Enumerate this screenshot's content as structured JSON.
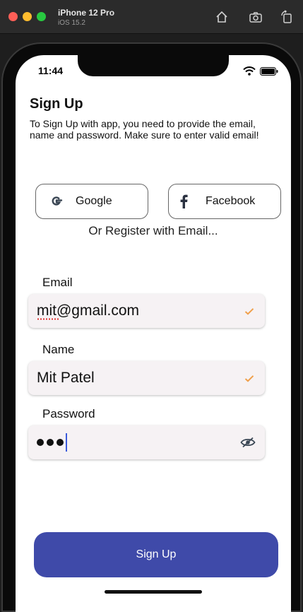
{
  "simulator": {
    "device_name": "iPhone 12 Pro",
    "os_version": "iOS 15.2"
  },
  "status_bar": {
    "time": "11:44"
  },
  "header": {
    "title": "Sign Up",
    "description": "To Sign Up with app, you need to provide the email, name  and password. Make sure to enter valid email!"
  },
  "social": {
    "google_label": "Google",
    "facebook_label": "Facebook",
    "google_icon": "google-g-icon",
    "facebook_icon": "facebook-f-icon"
  },
  "divider_text": "Or Register with Email...",
  "form": {
    "email": {
      "label": "Email",
      "value": "mit@gmail.com",
      "valid": true
    },
    "name": {
      "label": "Name",
      "value": "Mit Patel",
      "valid": true
    },
    "password": {
      "label": "Password",
      "masked_length": 3
    }
  },
  "submit_label": "Sign Up",
  "colors": {
    "primary": "#3f4aa9",
    "check": "#f0a04b",
    "field_bg": "#f6f2f4"
  }
}
